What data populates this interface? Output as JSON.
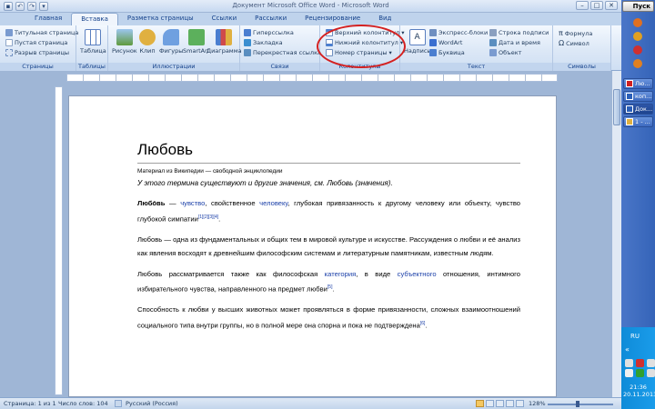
{
  "window": {
    "title": "Документ Microsoft Office Word - Microsoft Word"
  },
  "tabs": [
    "Главная",
    "Вставка",
    "Разметка страницы",
    "Ссылки",
    "Рассылки",
    "Рецензирование",
    "Вид"
  ],
  "ribbon": {
    "pages": {
      "label": "Страницы",
      "items": [
        "Титульная страница",
        "Пустая страница",
        "Разрыв страницы"
      ]
    },
    "tables": {
      "label": "Таблицы",
      "item": "Таблица"
    },
    "illustrations": {
      "label": "Иллюстрации",
      "items": [
        "Рисунок",
        "Клип",
        "Фигуры",
        "SmartArt",
        "Диаграмма"
      ]
    },
    "links": {
      "label": "Связи",
      "items": [
        "Гиперссылка",
        "Закладка",
        "Перекрестная ссылка"
      ]
    },
    "headers": {
      "label": "Колонтитулы",
      "items": [
        "Верхний колонтитул",
        "Нижний колонтитул",
        "Номер страницы"
      ]
    },
    "text": {
      "label": "Текст",
      "textbox": "Надпись",
      "items": [
        "Экспресс-блоки",
        "WordArt",
        "Буквица",
        "Строка подписи",
        "Дата и время",
        "Объект"
      ]
    },
    "symbols": {
      "label": "Символы",
      "items": [
        "Формула",
        "Символ"
      ]
    }
  },
  "document": {
    "title": "Любовь",
    "subtitle": "Материал из Википедии — свободной энциклопедии",
    "see_also": "У этого термина существуют и другие значения, см. Любовь (значения).",
    "p1": {
      "bold": "Любо́вь",
      "t1": " — ",
      "l1": "чувство",
      "t2": ", свойственное ",
      "l2": "человеку",
      "t3": ", глубокая привязанность к другому человеку или объекту, чувство глубокой симпатии",
      "refs": "[1][2][3][4]",
      "t4": "."
    },
    "p2": "Любовь — одна из фундаментальных и общих тем в мировой культуре и искусстве. Рассуждения о любви и её анализ как явления восходят к древнейшим философским системам и литературным памятникам, известным людям.",
    "p3": {
      "t1": "Любовь рассматривается также как философская ",
      "l1": "категория",
      "t2": ", в виде ",
      "l2": "субъектного",
      "t3": " отношения, интимного избирательного чувства, направленного на предмет любви",
      "ref": "[5]",
      "t4": "."
    },
    "p4": {
      "text": "Способность к любви у высших животных может проявляться в форме привязанности, сложных взаимоотношений социального типа внутри группы, но в полной мере она спорна и пока не подтверждена",
      "ref": "[6]",
      "t4": "."
    }
  },
  "status": {
    "page": "Страница: 1 из 1",
    "words": "Число слов: 104",
    "lang": "Русский (Россия)",
    "zoom": "128%"
  },
  "taskbar": {
    "start": "Пуск",
    "tasks": [
      "Лю...",
      "коп...",
      "Док...",
      "1 - ..."
    ],
    "lang": "RU",
    "time": "21:36",
    "date": "20.11.2013"
  },
  "colors": {
    "annotation": "#d42020",
    "link": "#1a3fa8"
  }
}
